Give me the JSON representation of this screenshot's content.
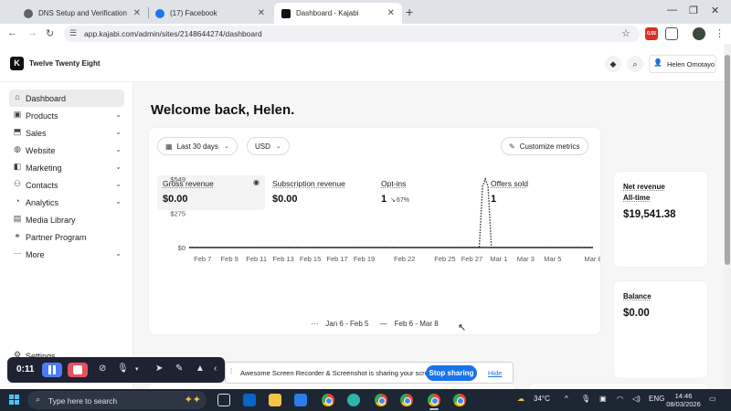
{
  "browser": {
    "tabs": [
      {
        "title": "DNS Setup and Verification",
        "active": false
      },
      {
        "title": "(17) Facebook",
        "active": false
      },
      {
        "title": "Dashboard - Kajabi",
        "active": true
      }
    ],
    "url": "app.kajabi.com/admin/sites/2148644274/dashboard",
    "ext_badge": "0.55"
  },
  "topbar": {
    "site_name": "Twelve Twenty Eight",
    "user_name": "Helen Omotayo"
  },
  "sidebar": {
    "items": [
      {
        "label": "Dashboard",
        "icon": "home-icon",
        "chevron": false,
        "active": true
      },
      {
        "label": "Products",
        "icon": "box-icon",
        "chevron": true,
        "active": false
      },
      {
        "label": "Sales",
        "icon": "tag-icon",
        "chevron": true,
        "active": false
      },
      {
        "label": "Website",
        "icon": "globe-icon",
        "chevron": true,
        "active": false
      },
      {
        "label": "Marketing",
        "icon": "megaphone-icon",
        "chevron": true,
        "active": false
      },
      {
        "label": "Contacts",
        "icon": "people-icon",
        "chevron": true,
        "active": false
      },
      {
        "label": "Analytics",
        "icon": "chart-icon",
        "chevron": true,
        "active": false
      },
      {
        "label": "Media Library",
        "icon": "media-icon",
        "chevron": false,
        "active": false
      },
      {
        "label": "Partner Program",
        "icon": "partner-icon",
        "chevron": false,
        "active": false
      },
      {
        "label": "More",
        "icon": "dots-icon",
        "chevron": true,
        "active": false
      }
    ],
    "settings_label": "Settings"
  },
  "main": {
    "welcome": "Welcome back, Helen.",
    "filters": {
      "date_range": "Last 30 days",
      "currency": "USD",
      "customize": "Customize metrics"
    },
    "metrics": [
      {
        "label": "Gross revenue",
        "value": "$0.00",
        "delta": "",
        "selected": true
      },
      {
        "label": "Subscription revenue",
        "value": "$0.00",
        "delta": "",
        "selected": false
      },
      {
        "label": "Opt-ins",
        "value": "1",
        "delta": "67%",
        "selected": false
      },
      {
        "label": "Offers sold",
        "value": "1",
        "delta": "",
        "selected": false
      }
    ],
    "side_cards": [
      {
        "label_line1": "Net revenue",
        "label_line2": "All-time",
        "value": "$19,541.38"
      },
      {
        "label_line1": "Balance",
        "label_line2": "",
        "value": "$0.00"
      }
    ]
  },
  "chart_data": {
    "type": "line",
    "x_ticks": [
      "Feb 7",
      "Feb 9",
      "Feb 11",
      "Feb 13",
      "Feb 15",
      "Feb 17",
      "Feb 19",
      "Feb 22",
      "Feb 25",
      "Feb 27",
      "Mar 1",
      "Mar 3",
      "Mar 5",
      "Mar 8"
    ],
    "y_ticks": [
      "$0",
      "$275",
      "$549"
    ],
    "ylim": [
      0,
      549
    ],
    "series": [
      {
        "name": "Jan 6 - Feb 5",
        "style": "dotted",
        "x": [
          "Feb 6",
          "Feb 7",
          "Feb 8",
          "Feb 9",
          "Feb 10",
          "Feb 11",
          "Feb 12",
          "Feb 13",
          "Feb 14",
          "Feb 15",
          "Feb 16",
          "Feb 17",
          "Feb 18",
          "Feb 19",
          "Feb 20",
          "Feb 21",
          "Feb 22",
          "Feb 23",
          "Feb 24",
          "Feb 25",
          "Feb 26",
          "Feb 27",
          "Feb 28",
          "Mar 1",
          "Mar 2",
          "Mar 3",
          "Mar 4",
          "Mar 5",
          "Mar 6",
          "Mar 7",
          "Mar 8"
        ],
        "values": [
          0,
          0,
          0,
          0,
          0,
          0,
          0,
          0,
          0,
          0,
          0,
          0,
          0,
          0,
          0,
          0,
          0,
          0,
          0,
          0,
          0,
          0,
          549,
          0,
          0,
          0,
          0,
          0,
          0,
          0,
          0
        ]
      },
      {
        "name": "Feb 6 - Mar 8",
        "style": "solid",
        "x": [
          "Feb 6",
          "Feb 7",
          "Feb 8",
          "Feb 9",
          "Feb 10",
          "Feb 11",
          "Feb 12",
          "Feb 13",
          "Feb 14",
          "Feb 15",
          "Feb 16",
          "Feb 17",
          "Feb 18",
          "Feb 19",
          "Feb 20",
          "Feb 21",
          "Feb 22",
          "Feb 23",
          "Feb 24",
          "Feb 25",
          "Feb 26",
          "Feb 27",
          "Feb 28",
          "Mar 1",
          "Mar 2",
          "Mar 3",
          "Mar 4",
          "Mar 5",
          "Mar 6",
          "Mar 7",
          "Mar 8"
        ],
        "values": [
          0,
          0,
          0,
          0,
          0,
          0,
          0,
          0,
          0,
          0,
          0,
          0,
          0,
          0,
          0,
          0,
          0,
          0,
          0,
          0,
          0,
          0,
          0,
          0,
          0,
          0,
          0,
          0,
          0,
          0,
          0
        ]
      }
    ],
    "grid": false,
    "legend": "bottom-center"
  },
  "recorder": {
    "time": "0:11",
    "share_message": "Awesome Screen Recorder & Screenshot is sharing your screen.",
    "stop_label": "Stop sharing",
    "hide_label": "Hide"
  },
  "taskbar": {
    "search_placeholder": "Type here to search",
    "temperature": "34°C",
    "language": "ENG",
    "time": "14:46",
    "date": "08/03/2026"
  },
  "colors": {
    "accent_blue": "#1a73e8",
    "chart_line": "#333333",
    "recorder_bg": "#1f2233"
  }
}
